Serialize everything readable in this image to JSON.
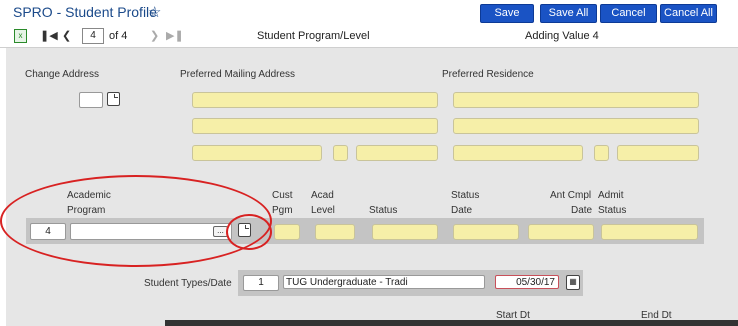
{
  "header": {
    "title": "SPRO - Student Profile",
    "star_icon": "star-icon",
    "buttons": {
      "save": "Save",
      "save_all": "Save All",
      "cancel": "Cancel",
      "cancel_all": "Cancel All"
    }
  },
  "nav": {
    "record_value": "4",
    "of_label": "of 4",
    "section": "Student Program/Level",
    "mode": "Adding Value 4"
  },
  "address": {
    "change_label": "Change Address",
    "mailing_label": "Preferred Mailing Address",
    "residence_label": "Preferred Residence"
  },
  "program": {
    "headers": {
      "academic": "Academic",
      "program": "Program",
      "cust": "Cust",
      "pgm": "Pgm",
      "acad": "Acad",
      "level": "Level",
      "status": "Status",
      "status_top": "Status",
      "date": "Date",
      "ant_cmpl": "Ant Cmpl",
      "cmpl_date": "Date",
      "admit": "Admit",
      "admit_status": "Status"
    },
    "row_number": "4",
    "picker": "..."
  },
  "student_types": {
    "label": "Student Types/Date",
    "number": "1",
    "value": "TUG Undergraduate - Tradi",
    "date": "05/30/17"
  },
  "dates": {
    "start": "Start Dt",
    "end": "End Dt"
  },
  "colors": {
    "accent": "#1a53c4",
    "field_yellow": "#f6efa8",
    "annotation_red": "#d82222"
  }
}
